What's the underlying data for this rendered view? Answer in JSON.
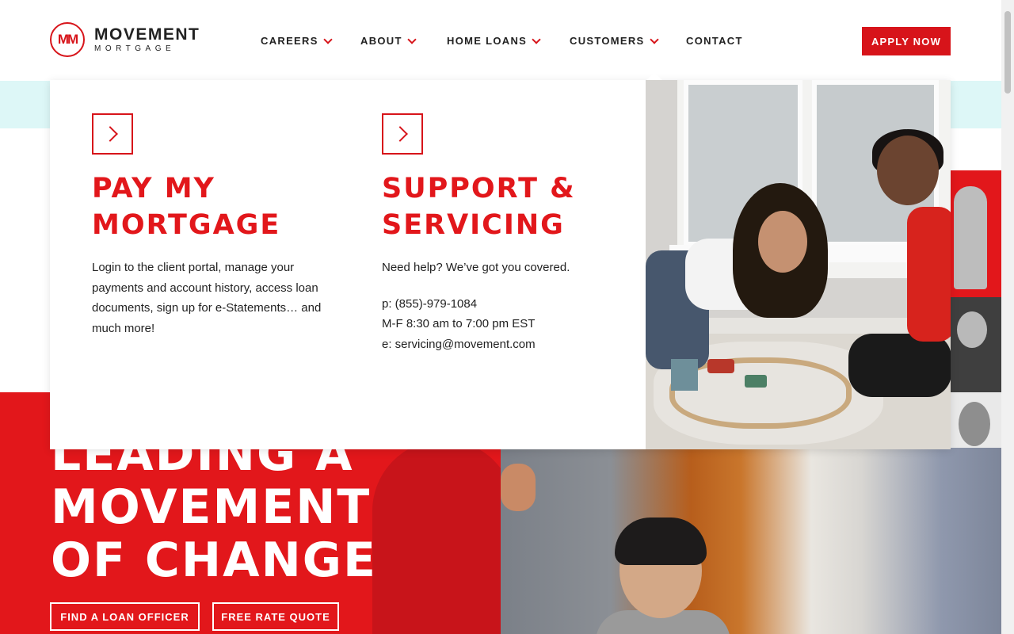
{
  "brand": {
    "initials": "MM",
    "name": "MOVEMENT",
    "sub": "MORTGAGE",
    "accent": "#d7141a"
  },
  "nav": {
    "items": [
      {
        "label": "CAREERS",
        "has_dropdown": true
      },
      {
        "label": "ABOUT",
        "has_dropdown": true
      },
      {
        "label": "HOME LOANS",
        "has_dropdown": true
      },
      {
        "label": "CUSTOMERS",
        "has_dropdown": true
      },
      {
        "label": "CONTACT",
        "has_dropdown": false
      }
    ],
    "apply_label": "APPLY NOW"
  },
  "dropdown": {
    "parent": "CUSTOMERS",
    "cards": [
      {
        "title_line1": "PAY MY",
        "title_line2": "MORTGAGE",
        "body": "Login to the client portal, manage your payments and account history, access loan documents, sign up for e-Statements… and much more!"
      },
      {
        "title_line1": "SUPPORT &",
        "title_line2": "SERVICING",
        "body": "Need help? We’ve got you covered.",
        "phone": "p: (855)-979-1084",
        "hours": "M-F 8:30 am to 7:00 pm EST",
        "email": "e: servicing@movement.com"
      }
    ]
  },
  "hero": {
    "title_line1": "LEADING A",
    "title_line2": "MOVEMENT",
    "title_line3": "OF CHANGE",
    "btn_find": "FIND A LOAN OFFICER",
    "btn_quote": "FREE RATE QUOTE",
    "hero_red": "#e2171b"
  }
}
